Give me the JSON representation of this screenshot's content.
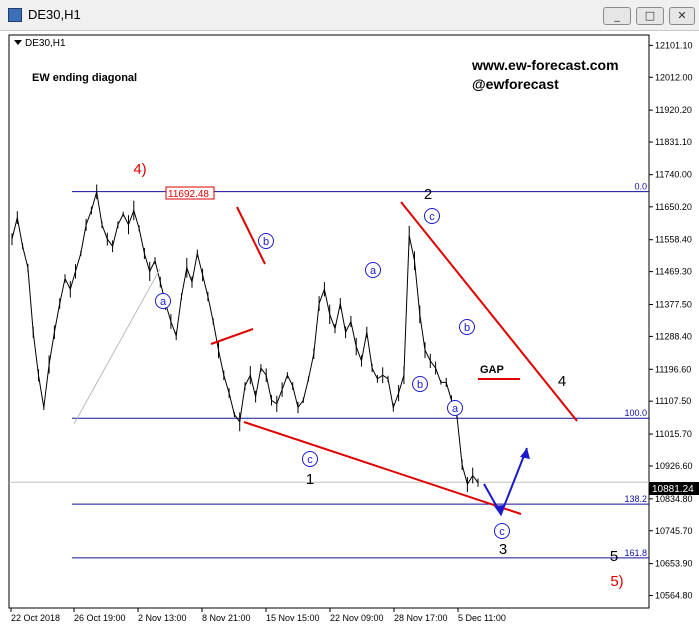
{
  "window": {
    "title": "DE30,H1",
    "buttons": [
      "_",
      "□",
      "✕"
    ],
    "icon": "chart-window-icon"
  },
  "chart_data": {
    "type": "line",
    "symbol_label": "DE30,H1",
    "annotation_title": "EW ending diagonal",
    "watermark": [
      "www.ew-forecast.com",
      "@ewforecast"
    ],
    "y_ticks": [
      12101.1,
      12012.0,
      11920.2,
      11831.1,
      11740.0,
      11650.2,
      11558.4,
      11469.3,
      11377.5,
      11288.4,
      11196.6,
      11107.5,
      11015.7,
      10926.6,
      10834.8,
      10745.7,
      10653.9,
      10564.8
    ],
    "ylim": [
      10530,
      12130
    ],
    "x_ticks": [
      "22 Oct 2018",
      "26 Oct 19:00",
      "2 Nov 13:00",
      "8 Nov 21:00",
      "15 Nov 15:00",
      "22 Nov 09:00",
      "28 Nov 17:00",
      "5 Dec 11:00"
    ],
    "current_price": "10881.24",
    "price_label": "11692.48",
    "fib_levels": [
      {
        "label": "0.0",
        "value": 11692.48
      },
      {
        "label": "100.0",
        "value": 11060
      },
      {
        "label": "138.2",
        "value": 10820
      },
      {
        "label": "161.8",
        "value": 10670
      }
    ],
    "series": [
      {
        "values": [
          11560,
          11620,
          11540,
          11480,
          11300,
          11180,
          11090,
          11210,
          11300,
          11380,
          11450,
          11420,
          11470,
          11520,
          11600,
          11640,
          11692,
          11600,
          11560,
          11540,
          11600,
          11630,
          11600,
          11640,
          11590,
          11520,
          11470,
          11500,
          11440,
          11380,
          11330,
          11290,
          11400,
          11480,
          11440,
          11520,
          11460,
          11400,
          11330,
          11250,
          11180,
          11130,
          11070,
          11050,
          11150,
          11180,
          11120,
          11200,
          11180,
          11110,
          11100,
          11140,
          11180,
          11150,
          11090,
          11110,
          11170,
          11240,
          11380,
          11420,
          11350,
          11310,
          11380,
          11300,
          11330,
          11260,
          11220,
          11300,
          11200,
          11170,
          11180,
          11170,
          11090,
          11130,
          11180,
          11570,
          11500,
          11350,
          11250,
          11220,
          11200,
          11160,
          11160,
          11110,
          11070,
          10930,
          10875,
          10900,
          10880
        ]
      }
    ],
    "wave_labels": [
      {
        "text": "4)",
        "color": "#e00000",
        "style": "plain"
      },
      {
        "text": "a",
        "color": "#1a1acc",
        "style": "circle"
      },
      {
        "text": "b",
        "color": "#1a1acc",
        "style": "circle"
      },
      {
        "text": "c",
        "color": "#1a1acc",
        "style": "circle"
      },
      {
        "text": "1",
        "color": "#000000",
        "style": "plain"
      },
      {
        "text": "a",
        "color": "#1a1acc",
        "style": "circle"
      },
      {
        "text": "b",
        "color": "#1a1acc",
        "style": "circle"
      },
      {
        "text": "2",
        "color": "#000000",
        "style": "plain"
      },
      {
        "text": "c",
        "color": "#1a1acc",
        "style": "circle"
      },
      {
        "text": "b",
        "color": "#1a1acc",
        "style": "circle"
      },
      {
        "text": "a",
        "color": "#1a1acc",
        "style": "circle"
      },
      {
        "text": "c",
        "color": "#1a1acc",
        "style": "circle"
      },
      {
        "text": "3",
        "color": "#000000",
        "style": "plain"
      },
      {
        "text": "4",
        "color": "#000000",
        "style": "plain"
      },
      {
        "text": "5",
        "color": "#000000",
        "style": "plain"
      },
      {
        "text": "5)",
        "color": "#e00000",
        "style": "plain"
      }
    ],
    "gap_label": "GAP",
    "colors": {
      "price": "#000000",
      "trendline": "#e00000",
      "fib": "#1010a0",
      "arrow": "#1a1acc"
    },
    "grid": false
  }
}
